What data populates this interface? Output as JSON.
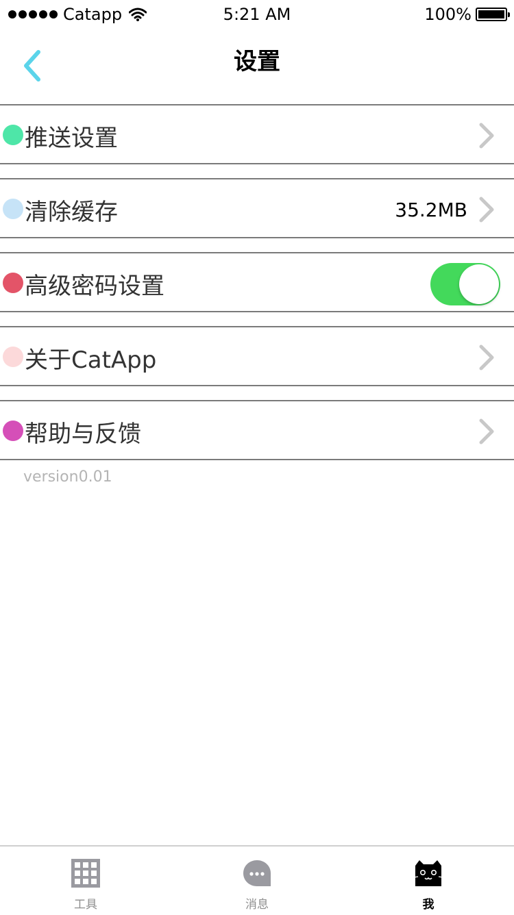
{
  "status_bar": {
    "carrier": "Catapp",
    "time": "5:21 AM",
    "battery": "100%",
    "signal_icon": "signal-dots-icon",
    "wifi_icon": "wifi-icon",
    "battery_icon": "battery-icon"
  },
  "nav": {
    "title": "设置",
    "back_icon": "chevron-left-icon",
    "accent_color": "#5bd4ea"
  },
  "settings": [
    {
      "label": "推送设置",
      "dot_color": "#4ee6a8",
      "accessory": "chevron"
    },
    {
      "label": "清除缓存",
      "dot_color": "#c6e3f7",
      "accessory": "chevron",
      "value": "35.2MB"
    },
    {
      "label": "高级密码设置",
      "dot_color": "#e35468",
      "accessory": "toggle",
      "toggle_on": true,
      "toggle_color": "#43d95b"
    },
    {
      "label": "关于CatApp",
      "dot_color": "#fcd9da",
      "accessory": "chevron"
    },
    {
      "label": "帮助与反馈",
      "dot_color": "#d54fb8",
      "accessory": "chevron"
    }
  ],
  "version": "version0.01",
  "tabs": [
    {
      "label": "工具",
      "icon": "grid-icon",
      "active": false
    },
    {
      "label": "消息",
      "icon": "message-bubble-icon",
      "active": false
    },
    {
      "label": "我",
      "icon": "cat-face-icon",
      "active": true
    }
  ]
}
